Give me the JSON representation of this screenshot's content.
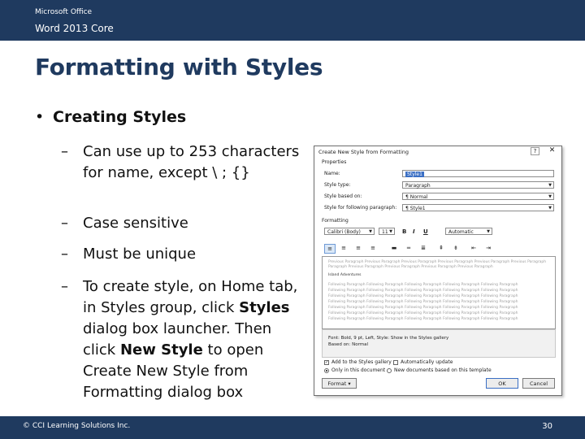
{
  "header": {
    "line1": "Microsoft Office",
    "line2": "Word 2013 Core"
  },
  "slide": {
    "title": "Formatting with Styles",
    "bullet_symbol": "•",
    "bullet": "Creating Styles",
    "dash": "–",
    "subbullets": [
      "Can use up to 253 characters for name, except \\ ; {}",
      "Case sensitive",
      "Must be unique"
    ],
    "last": {
      "part1": "To create style, on Home tab, in Styles group, click ",
      "bold1": "Styles",
      "part2": " dialog box launcher. Then click ",
      "bold2": "New Style",
      "part3": " to open Create New Style from Formatting dialog box"
    }
  },
  "dialog": {
    "title": "Create New Style from Formatting",
    "help": "?",
    "close": "✕",
    "properties_label": "Properties",
    "name_label": "Name:",
    "name_value": "Style1",
    "style_type_label": "Style type:",
    "style_type_value": "Paragraph",
    "based_on_label": "Style based on:",
    "based_on_value": "¶ Normal",
    "following_label": "Style for following paragraph:",
    "following_value": "¶ Style1",
    "formatting_label": "Formatting",
    "font_value": "Calibri (Body)",
    "size_value": "11",
    "bold": "B",
    "italic": "I",
    "underline": "U",
    "color_value": "Automatic",
    "preview_prev": "Previous Paragraph Previous Paragraph Previous Paragraph Previous Paragraph Previous Paragraph Previous Paragraph",
    "preview_prev2": "Paragraph Previous Paragraph Previous Paragraph Previous Paragraph Previous Paragraph",
    "preview_sample": "Island Adventures",
    "preview_follow": "Following Paragraph Following Paragraph Following Paragraph Following Paragraph Following Paragraph",
    "description_line1": "Font: Bold, 9 pt, Left, Style: Show in the Styles gallery",
    "description_line2": "Based on: Normal",
    "add_gallery_label": "Add to the Styles gallery",
    "auto_update_label": "Automatically update",
    "only_doc_label": "Only in this document",
    "new_docs_label": "New documents based on this template",
    "format_button": "Format ▾",
    "ok_button": "OK",
    "cancel_button": "Cancel"
  },
  "footer": {
    "copyright": "© CCI Learning Solutions Inc.",
    "page": "30"
  },
  "colors": {
    "navy": "#1f3a5f",
    "accent": "#3b6fc4"
  }
}
